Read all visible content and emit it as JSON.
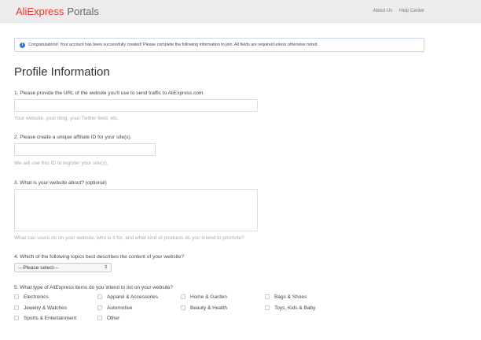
{
  "header": {
    "logo_ali": "Ali",
    "logo_express": "Express",
    "logo_portals": "Portals",
    "links": [
      "About Us",
      "Help Center"
    ]
  },
  "notice": {
    "icon": "info-icon",
    "text": "Congratulations! Your account has been successfully created! Please complete the following information to join. All fields are required unless otherwise noted."
  },
  "page_title": "Profile Information",
  "q1": {
    "label": "1. Please provide the URL of the website you'll use to send traffic to AliExpress.com.",
    "value": "",
    "hint": "Your website, your blog, your Twitter feed, etc."
  },
  "q2": {
    "label": "2. Please create a unique affiliate ID for your site(s).",
    "value": "",
    "hint": "We will use this ID to register your site(s)."
  },
  "q3": {
    "label": "3. What is your website about? (optional)",
    "value": "",
    "hint": "What can users do on your website, who is it for, and what kind of products do you intend to promote?"
  },
  "q4": {
    "label": "4. Which of the following topics best describes the content of your website?",
    "selected": "---Please select---"
  },
  "q5": {
    "label": "5. What type of AliExpress items do you intend to list on your website?",
    "options": [
      "Electronics",
      "Apparel & Accessories",
      "Home & Garden",
      "Bags & Shoes",
      "Jewelry & Watches",
      "Automotive",
      "Beauty & Health",
      "Toys, Kids & Baby",
      "Sports & Entertainment",
      "Other"
    ]
  }
}
